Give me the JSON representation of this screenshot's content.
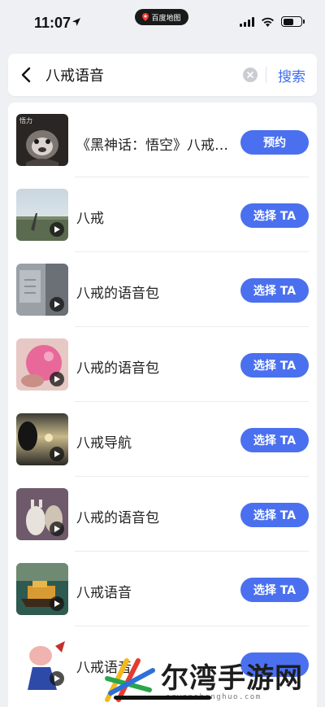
{
  "status_bar": {
    "time": "11:07",
    "carrier_badge": "百度地图",
    "battery_level": 0.6
  },
  "search": {
    "back_icon": "chevron-left-icon",
    "query": "八戒语音",
    "clear_icon": "clear-circle-icon",
    "search_label": "搜索"
  },
  "results": [
    {
      "title": "《黑神话：悟空》八戒…",
      "button": "预约",
      "thumb_theme": "dark-creature",
      "thumb_caption": "悟力"
    },
    {
      "title": "八戒",
      "button": "选择 TA",
      "thumb_theme": "sky-field"
    },
    {
      "title": "八戒的语音包",
      "button": "选择 TA",
      "thumb_theme": "gray-building"
    },
    {
      "title": "八戒的语音包",
      "button": "选择 TA",
      "thumb_theme": "pink-balloon"
    },
    {
      "title": "八戒导航",
      "button": "选择 TA",
      "thumb_theme": "sunset-dark"
    },
    {
      "title": "八戒的语音包",
      "button": "选择 TA",
      "thumb_theme": "alpaca"
    },
    {
      "title": "八戒语音",
      "button": "选择 TA",
      "thumb_theme": "ship-night"
    },
    {
      "title": "八戒语音",
      "button": "",
      "thumb_theme": "cartoon-pig"
    }
  ],
  "colors": {
    "accent": "#4a70ef",
    "search_text": "#3d6cf0",
    "background": "#eef0f4"
  },
  "watermark": {
    "text": "尔湾手游网",
    "sub": "erwanshenghuo.com"
  }
}
